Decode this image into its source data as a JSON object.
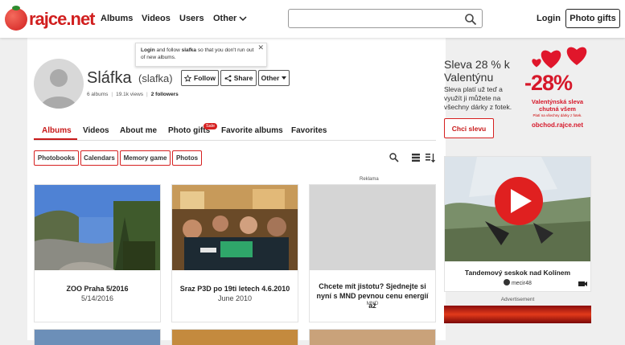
{
  "header": {
    "logo_text": "rajce",
    "logo_dot": ".net",
    "nav": [
      "Albums",
      "Videos",
      "Users",
      "Other"
    ],
    "search_placeholder": "",
    "login": "Login",
    "photo_gifts": "Photo gifts"
  },
  "profile": {
    "name": "Sláfka",
    "nick": "(slafka)",
    "tooltip_login": "Login",
    "tooltip_mid": " and follow ",
    "tooltip_user": "slafka",
    "tooltip_rest": " so that you don't run out of new albums.",
    "follow": "Follow",
    "share": "Share",
    "other": "Other",
    "albums": "6 albums",
    "views": "19.1k views",
    "followers": "2 followers"
  },
  "tabs": [
    {
      "label": "Albums",
      "active": true
    },
    {
      "label": "Videos"
    },
    {
      "label": "About me"
    },
    {
      "label": "Photo gifts",
      "badge": "Sale"
    },
    {
      "label": "Favorite albums"
    },
    {
      "label": "Favorites"
    }
  ],
  "chips": [
    "Photobooks",
    "Calendars",
    "Memory game",
    "Photos"
  ],
  "albums": [
    {
      "title": "ZOO Praha 5/2016",
      "date": "5/14/2016"
    },
    {
      "title": "Sraz P3D po 19ti letech 4.6.2010",
      "date": "June 2010"
    }
  ],
  "ad_card": {
    "label": "Reklama",
    "title": "Chcete mít jistotu? Sjednejte si nyní s MND pevnou cenu energií až",
    "sponsor": "MND"
  },
  "promo": {
    "title": "Sleva 28 % k Valentýnu",
    "text": "Sleva platí už teď a využít ji můžete na všechny dárky z fotek.",
    "button": "Chci slevu",
    "big": "-28%",
    "sub": "Valentýnská sleva chutná všem",
    "small": "Platí na všechny dárky z fotek.",
    "shop": "obchod.rajce.net"
  },
  "video": {
    "title": "Tandemový seskok nad Kolínem",
    "user": "mecir48"
  },
  "advert_label": "Advertisement",
  "colors": {
    "brand": "#d11f1f",
    "accent": "#c81a1a"
  }
}
